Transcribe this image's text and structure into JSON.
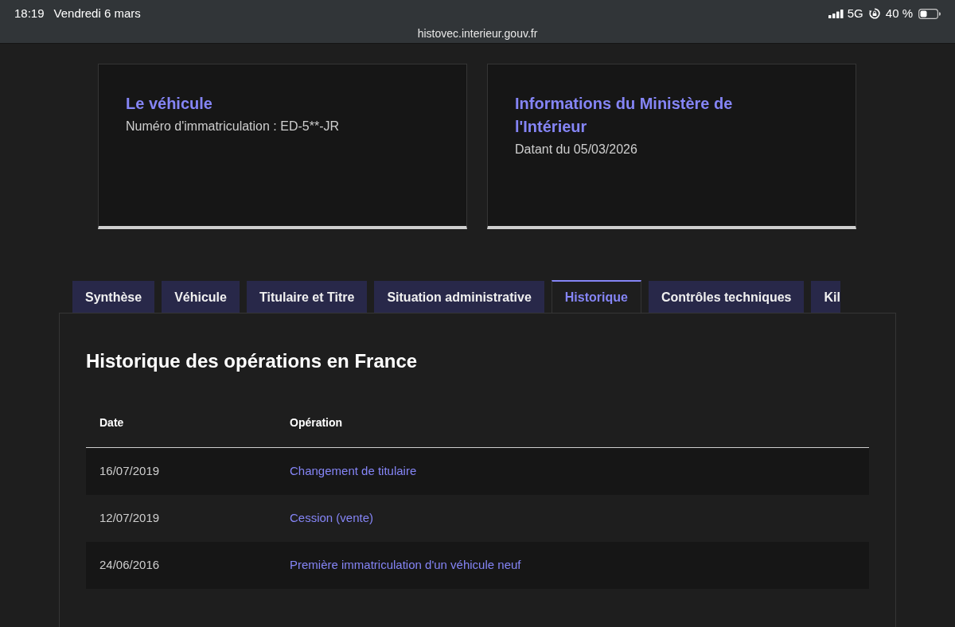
{
  "status_bar": {
    "time": "18:19",
    "date": "Vendredi 6 mars",
    "network": "5G",
    "battery_text": "40 %",
    "url": "histovec.interieur.gouv.fr"
  },
  "cards": [
    {
      "title": "Le véhicule",
      "text": "Numéro d'immatriculation : ED-5**-JR"
    },
    {
      "title": "Informations du Ministère de l'Intérieur",
      "text": "Datant du 05/03/2026"
    }
  ],
  "tabs": [
    {
      "label": "Synthèse",
      "selected": false
    },
    {
      "label": "Véhicule",
      "selected": false
    },
    {
      "label": "Titulaire et Titre",
      "selected": false
    },
    {
      "label": "Situation administrative",
      "selected": false
    },
    {
      "label": "Historique",
      "selected": true
    },
    {
      "label": "Contrôles techniques",
      "selected": false
    },
    {
      "label": "Kil",
      "selected": false
    }
  ],
  "panel": {
    "heading": "Historique des opérations en France",
    "table": {
      "columns": [
        "Date",
        "Opération"
      ],
      "rows": [
        {
          "date": "16/07/2019",
          "operation": "Changement de titulaire"
        },
        {
          "date": "12/07/2019",
          "operation": "Cession (vente)"
        },
        {
          "date": "24/06/2016",
          "operation": "Première immatriculation d'un véhicule neuf"
        }
      ]
    }
  }
}
